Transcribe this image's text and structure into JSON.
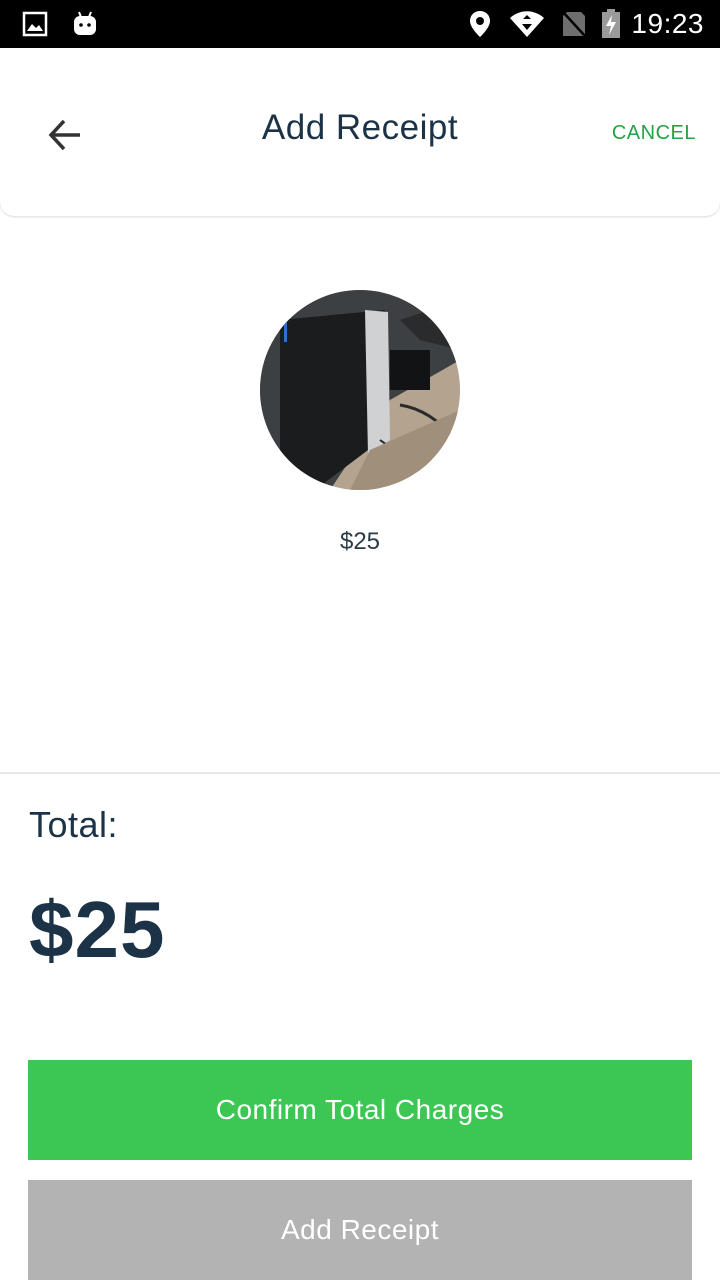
{
  "status_bar": {
    "time": "19:23",
    "icons": [
      "image-notification-icon",
      "android-notification-icon",
      "location-icon",
      "wifi-icon",
      "no-sim-icon",
      "battery-charging-icon"
    ]
  },
  "app_bar": {
    "title": "Add Receipt",
    "cancel_label": "CANCEL",
    "back_icon": "arrow-left-icon"
  },
  "receipt": {
    "amount": "$25"
  },
  "summary": {
    "total_label": "Total:",
    "total_value": "$25"
  },
  "actions": {
    "confirm_label": "Confirm Total Charges",
    "add_receipt_label": "Add Receipt"
  },
  "colors": {
    "accent_green": "#3cc654",
    "cancel_green": "#27a244",
    "title_navy": "#1c3347",
    "disabled_gray": "#b3b3b3"
  }
}
